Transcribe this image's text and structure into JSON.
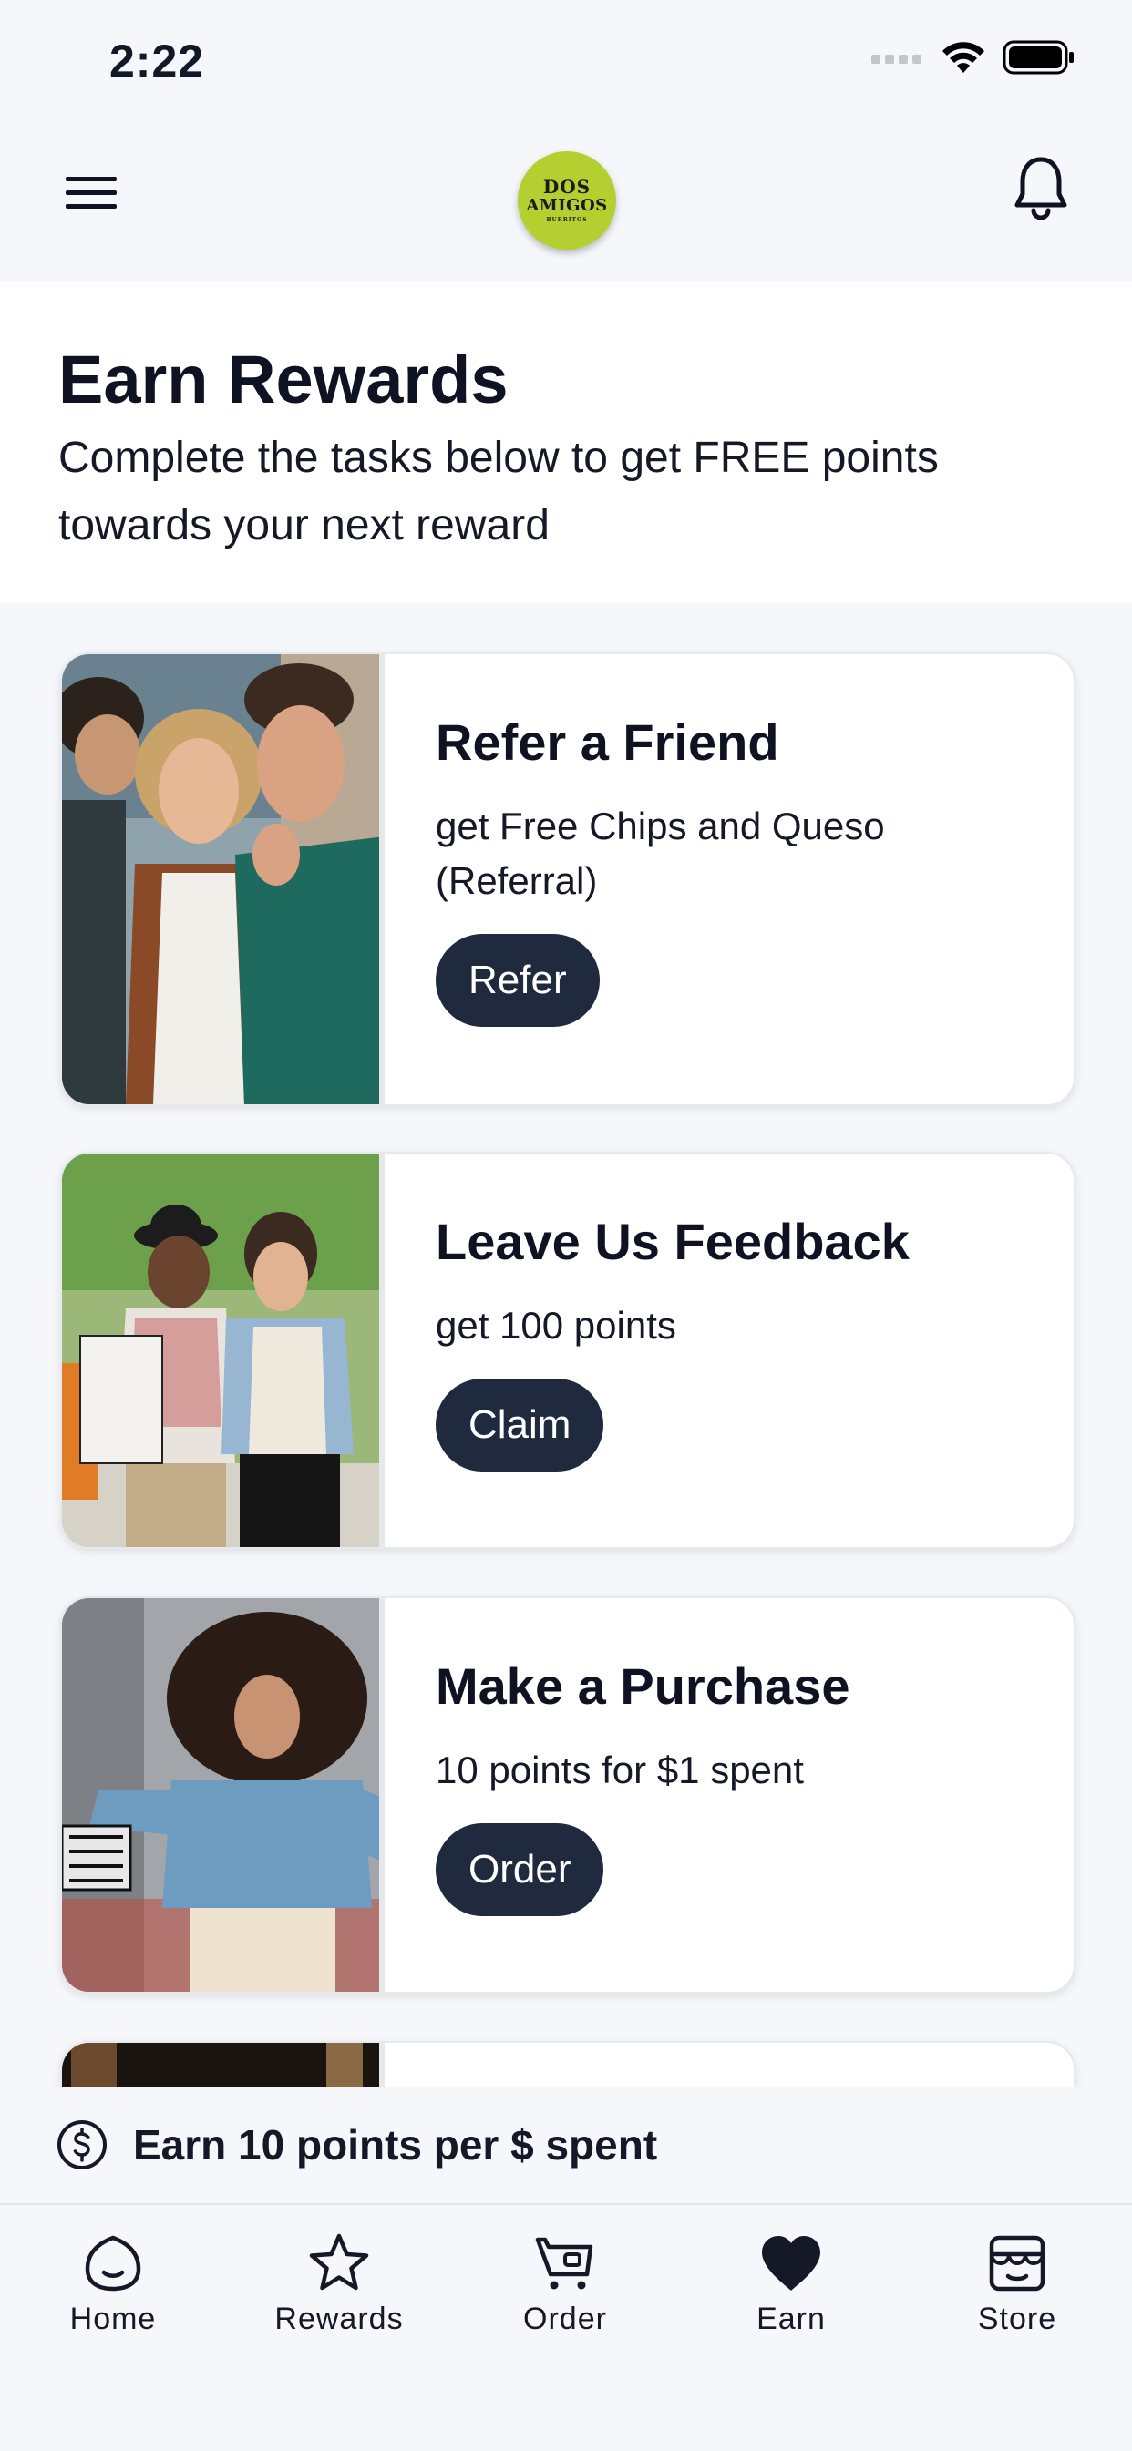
{
  "status_bar": {
    "time": "2:22",
    "icons": [
      "cellular-icon",
      "wifi-icon",
      "battery-icon"
    ]
  },
  "top_bar": {
    "logo": {
      "line1": "DOS",
      "line2": "AMIGOS",
      "line3": "BURRITOS"
    },
    "icons": [
      "menu-icon",
      "bell-icon"
    ]
  },
  "header": {
    "title": "Earn Rewards",
    "subtitle": "Complete the tasks below to get FREE points towards your next reward"
  },
  "cards": [
    {
      "title": "Refer a Friend",
      "description": "get Free Chips and Queso (Referral)",
      "button": "Refer"
    },
    {
      "title": "Leave Us Feedback",
      "description": "get 100 points",
      "button": "Claim"
    },
    {
      "title": "Make a Purchase",
      "description": "10 points for $1 spent",
      "button": "Order"
    }
  ],
  "earn_strip": {
    "icon": "dollar-circle-icon",
    "text": "Earn 10 points per $ spent"
  },
  "tabs": [
    {
      "label": "Home",
      "icon": "home-icon"
    },
    {
      "label": "Rewards",
      "icon": "star-icon"
    },
    {
      "label": "Order",
      "icon": "cart-icon"
    },
    {
      "label": "Earn",
      "icon": "heart-icon",
      "active": true
    },
    {
      "label": "Store",
      "icon": "store-icon"
    }
  ],
  "colors": {
    "background": "#f6f7fa",
    "button": "#1f2a3f",
    "logo": "#b4cf2f",
    "text": "#0f1222"
  }
}
